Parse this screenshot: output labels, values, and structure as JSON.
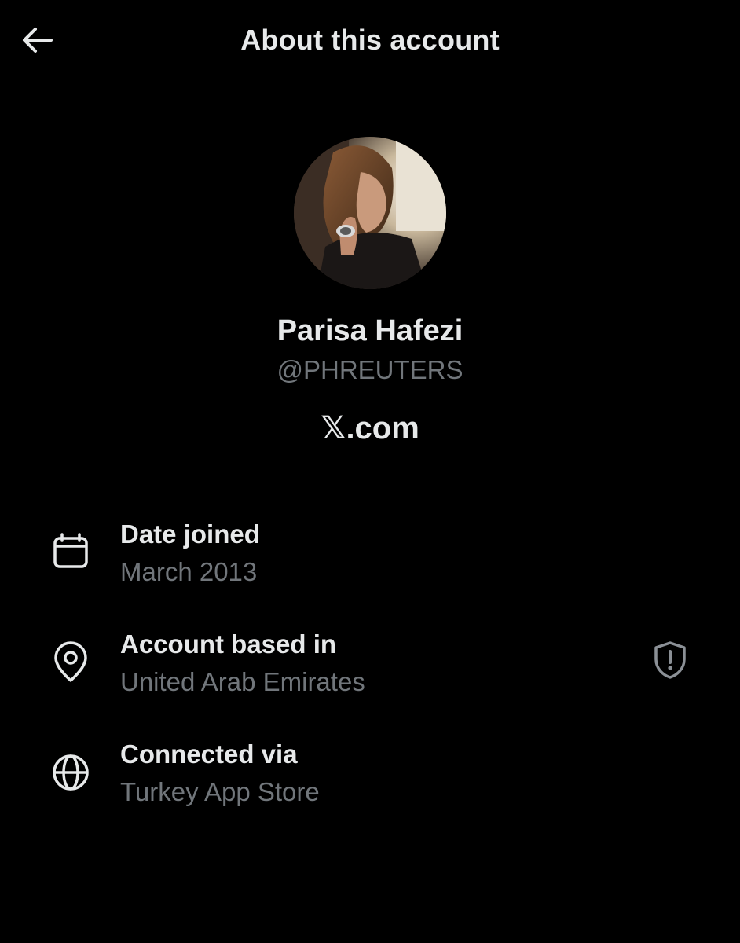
{
  "header": {
    "back_icon": "arrow-left-icon",
    "title": "About this account"
  },
  "profile": {
    "avatar_description_icon": "profile-photo",
    "display_name": "Parisa Hafezi",
    "handle": "@PHREUTERS",
    "brand_glyph": "𝕏",
    "brand_suffix": ".com"
  },
  "details": [
    {
      "icon": "calendar-icon",
      "label": "Date joined",
      "value": "March 2013"
    },
    {
      "icon": "location-pin-icon",
      "label": "Account based in",
      "value": "United Arab Emirates",
      "trailing_icon": "shield-alert-icon"
    },
    {
      "icon": "globe-icon",
      "label": "Connected via",
      "value": "Turkey App Store"
    }
  ],
  "colors": {
    "background": "#000000",
    "primary_text": "#e7e9ea",
    "secondary_text": "#71767b",
    "icon": "#e7e9ea",
    "shield_icon": "#8b9096"
  }
}
